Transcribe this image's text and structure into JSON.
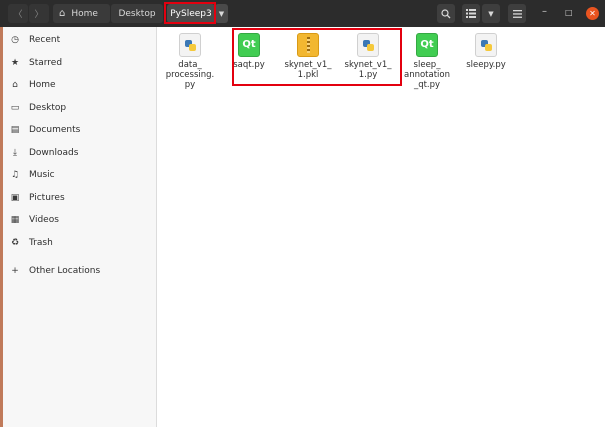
{
  "header": {
    "back_icon": "chevron-left-icon",
    "forward_icon": "chevron-right-icon",
    "breadcrumbs": [
      {
        "label": "Home",
        "icon": "home-icon"
      },
      {
        "label": "Desktop"
      },
      {
        "label": "PySleep3",
        "current": true
      }
    ],
    "dropdown_icon": "caret-down-icon",
    "search_icon": "search-icon",
    "view_icon": "list-view-icon",
    "menu_icon": "hamburger-menu-icon",
    "window_controls": [
      "minimize-icon",
      "maximize-icon",
      "close-icon"
    ]
  },
  "sidebar": {
    "items": [
      {
        "label": "Recent",
        "icon": "clock-icon"
      },
      {
        "label": "Starred",
        "icon": "star-icon"
      },
      {
        "label": "Home",
        "icon": "home-icon"
      },
      {
        "label": "Desktop",
        "icon": "desktop-icon"
      },
      {
        "label": "Documents",
        "icon": "documents-icon"
      },
      {
        "label": "Downloads",
        "icon": "download-icon"
      },
      {
        "label": "Music",
        "icon": "music-icon"
      },
      {
        "label": "Pictures",
        "icon": "pictures-icon"
      },
      {
        "label": "Videos",
        "icon": "videos-icon"
      },
      {
        "label": "Trash",
        "icon": "trash-icon"
      },
      {
        "label": "Other Locations",
        "icon": "plus-icon"
      }
    ]
  },
  "files": [
    {
      "lines": [
        "data_",
        "processing.",
        "py"
      ],
      "type": "python"
    },
    {
      "lines": [
        "saqt.py"
      ],
      "type": "qt"
    },
    {
      "lines": [
        "skynet_v1_",
        "1.pkl"
      ],
      "type": "archive"
    },
    {
      "lines": [
        "skynet_v1_",
        "1.py"
      ],
      "type": "python"
    },
    {
      "lines": [
        "sleep_",
        "annotation",
        "_qt.py"
      ],
      "type": "qt"
    },
    {
      "lines": [
        "sleepy.py"
      ],
      "type": "python"
    }
  ],
  "icon_labels": {
    "qt": "Qt"
  },
  "colors": {
    "highlight": "#e3000f",
    "headerbar": "#2c2c2c",
    "close_button": "#e95420",
    "qt_green": "#41cd52"
  }
}
